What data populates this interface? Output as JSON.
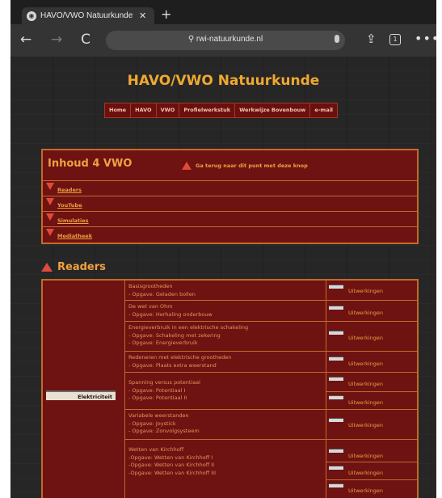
{
  "browser": {
    "tab_title": "HAVO/VWO Natuurkunde",
    "tab_close": "✕",
    "new_tab": "+",
    "url": "rwi-natuurkunde.nl",
    "url_prefix_icon": "⚲",
    "tab_count": "1",
    "more": "•••",
    "back": "←",
    "forward": "→",
    "reload": "C",
    "share": "⇪"
  },
  "site": {
    "title": "HAVO/VWO Natuurkunde",
    "menu": [
      "Home",
      "HAVO",
      "VWO",
      "Profielwerkstuk",
      "Werkwijze Bovenbouw",
      "e-mail"
    ]
  },
  "inhoud": {
    "title": "Inhoud 4 VWO",
    "back_text": "Ga terug naar dit punt met deze knop",
    "items": [
      "Readers",
      "YouTube",
      "Simulaties",
      "Mediatheek"
    ]
  },
  "readers": {
    "title": "Readers",
    "category": "Elektriciteit",
    "link_text": "Uitwerkingen",
    "rows": [
      {
        "lines": [
          "Basisgrootheden",
          "- Opgave: Geladen bollen"
        ]
      },
      {
        "lines": [
          "De wet van Ohm",
          "- Opgave: Herhaling onderbouw"
        ]
      },
      {
        "lines": [
          "Energieverbruik in een elektrische schakeling",
          "- Opgave: Schakeling met zekering",
          "- Opgave: Energieverbruik"
        ]
      },
      {
        "lines": [
          "Redeneren met elektrische grootheden",
          "- Opgave: Plaats extra weerstand"
        ]
      },
      {
        "lines": [
          "Spanning versus potentiaal",
          "- Opgave: Potentiaal I",
          "- Opgave: Potentiaal II"
        ]
      },
      {
        "lines": [
          "Variabele weerstanden",
          "- Opgave: Joystick",
          "- Opgave: Zonvolgsysteem"
        ]
      },
      {
        "lines": [
          "",
          "Wetten van Kirchhoff",
          "-Opgave: Wetten van Kirchhoff I",
          "-Opgave: Wetten van Kirchhoff II",
          "-Opgave: Wetten van Kirchhoff III"
        ]
      }
    ]
  },
  "icons": {
    "favicon": "globe-icon",
    "file": "file-icon"
  }
}
